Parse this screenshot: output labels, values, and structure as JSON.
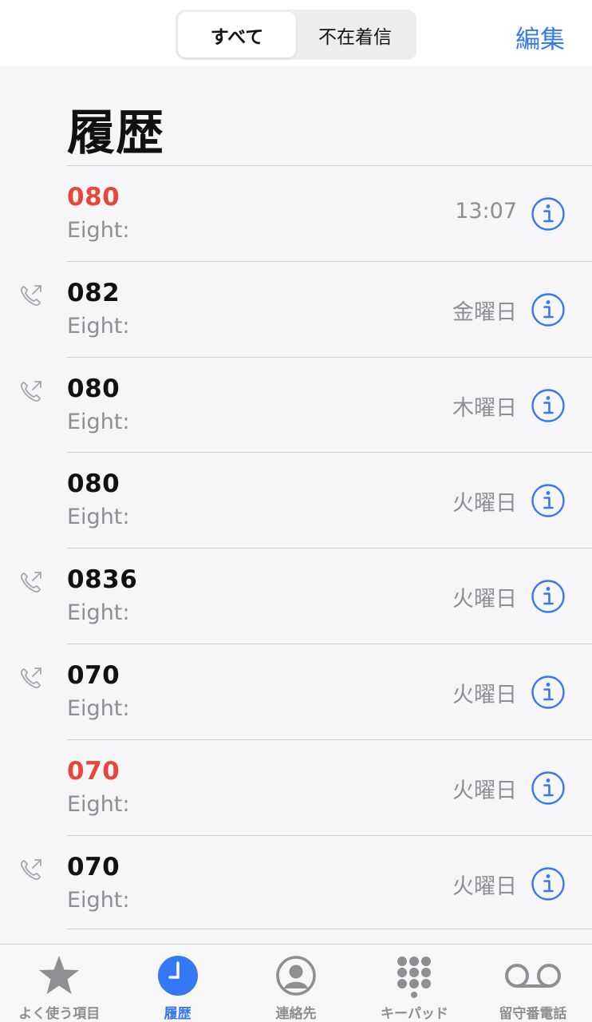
{
  "header": {
    "segments": [
      "すべて",
      "不在着信"
    ],
    "active_segment": 0,
    "edit_label": "編集",
    "title": "履歴"
  },
  "colors": {
    "accent": "#3478f6",
    "missed": "#e8463a",
    "secondary_text": "#8e8e93"
  },
  "calls": [
    {
      "number": "080",
      "label": "Eight:",
      "time": "13:07",
      "missed": true,
      "outgoing": false
    },
    {
      "number": "082",
      "label": "Eight:",
      "time": "金曜日",
      "missed": false,
      "outgoing": true
    },
    {
      "number": "080",
      "label": "Eight:",
      "time": "木曜日",
      "missed": false,
      "outgoing": true
    },
    {
      "number": "080",
      "label": "Eight:",
      "time": "火曜日",
      "missed": false,
      "outgoing": false
    },
    {
      "number": "0836",
      "label": "Eight:",
      "time": "火曜日",
      "missed": false,
      "outgoing": true
    },
    {
      "number": "070",
      "label": "Eight:",
      "time": "火曜日",
      "missed": false,
      "outgoing": true
    },
    {
      "number": "070",
      "label": "Eight:",
      "time": "火曜日",
      "missed": true,
      "outgoing": false
    },
    {
      "number": "070",
      "label": "Eight:",
      "time": "火曜日",
      "missed": false,
      "outgoing": true
    }
  ],
  "tabs": [
    {
      "label": "よく使う項目",
      "icon": "star-icon",
      "active": false
    },
    {
      "label": "履歴",
      "icon": "clock-icon",
      "active": true
    },
    {
      "label": "連絡先",
      "icon": "contact-icon",
      "active": false
    },
    {
      "label": "キーパッド",
      "icon": "keypad-icon",
      "active": false
    },
    {
      "label": "留守番電話",
      "icon": "voicemail-icon",
      "active": false
    }
  ]
}
